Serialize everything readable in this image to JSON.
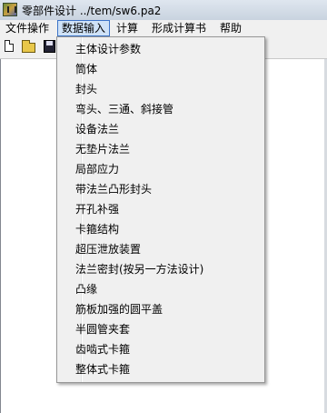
{
  "window": {
    "title": "零部件设计 ../tem/sw6.pa2"
  },
  "menubar": {
    "items": [
      {
        "label": "文件操作"
      },
      {
        "label": "数据输入"
      },
      {
        "label": "计算"
      },
      {
        "label": "形成计算书"
      },
      {
        "label": "帮助"
      }
    ]
  },
  "toolbar": {
    "icons": [
      "new-file-icon",
      "open-folder-icon",
      "save-icon"
    ]
  },
  "dropdown": {
    "items": [
      {
        "label": "主体设计参数"
      },
      {
        "label": "筒体"
      },
      {
        "label": "封头"
      },
      {
        "label": "弯头、三通、斜接管"
      },
      {
        "label": "设备法兰"
      },
      {
        "label": "无垫片法兰"
      },
      {
        "label": "局部应力"
      },
      {
        "label": "带法兰凸形封头"
      },
      {
        "label": "开孔补强"
      },
      {
        "label": "卡箍结构"
      },
      {
        "label": "超压泄放装置"
      },
      {
        "label": "法兰密封(按另一方法设计)"
      },
      {
        "label": "凸缘"
      },
      {
        "label": "筋板加强的圆平盖"
      },
      {
        "label": "半圆管夹套"
      },
      {
        "label": "齿啮式卡箍"
      },
      {
        "label": "整体式卡箍"
      }
    ]
  }
}
